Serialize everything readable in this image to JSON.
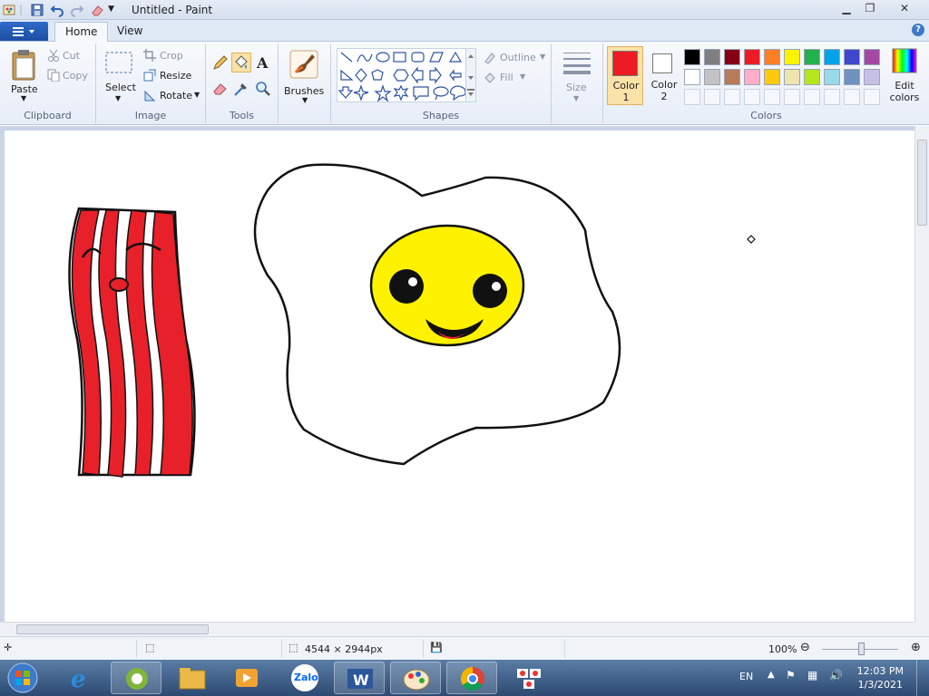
{
  "window": {
    "title": "Untitled - Paint"
  },
  "tabs": [
    {
      "label": "Home"
    },
    {
      "label": "View"
    }
  ],
  "clipboard": {
    "paste_label": "Paste",
    "cut_label": "Cut",
    "copy_label": "Copy",
    "group_label": "Clipboard"
  },
  "image": {
    "select_label": "Select",
    "crop_label": "Crop",
    "resize_label": "Resize",
    "rotate_label": "Rotate",
    "group_label": "Image"
  },
  "tools": {
    "group_label": "Tools",
    "selected": "fill-icon"
  },
  "brushes": {
    "label": "Brushes"
  },
  "shapes": {
    "outline_label": "Outline",
    "fill_label": "Fill",
    "group_label": "Shapes"
  },
  "size": {
    "label": "Size"
  },
  "colors": {
    "color1_label": "Color 1",
    "color2_label": "Color 2",
    "color1": "#ed1c24",
    "color2": "#ffffff",
    "edit_label": "Edit colors",
    "group_label": "Colors",
    "palette_row1": [
      "#000000",
      "#7f7f7f",
      "#880015",
      "#ed1c24",
      "#ff7f27",
      "#fff200",
      "#22b14c",
      "#00a2e8",
      "#3f48cc",
      "#a349a4"
    ],
    "palette_row2": [
      "#ffffff",
      "#c3c3c3",
      "#b97a57",
      "#ffaec9",
      "#ffc90e",
      "#efe4b0",
      "#b5e61d",
      "#99d9ea",
      "#7092be",
      "#c8bfe7"
    ]
  },
  "status": {
    "dimensions": "4544 × 2944px",
    "zoom": "100%"
  },
  "taskbar": {
    "language": "EN",
    "time": "12:03 PM",
    "date": "1/3/2021",
    "zalo_label": "Zalo"
  }
}
